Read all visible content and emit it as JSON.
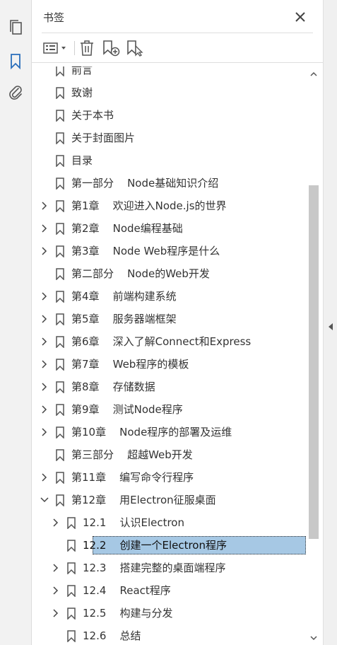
{
  "panel": {
    "title": "书签"
  },
  "colors": {
    "accent": "#2a6ebb",
    "selection_bg": "#a6c8e4",
    "scroll_thumb": "#c8c8c8",
    "rail_bg": "#f2f2f2"
  },
  "rail": {
    "icons": [
      "pages-icon",
      "bookmark-icon",
      "attachment-icon"
    ],
    "active": "bookmark-icon"
  },
  "toolbar": {
    "icons": [
      "options-menu-icon",
      "delete-bookmark-icon",
      "new-bookmark-icon",
      "bookmark-from-selection-icon"
    ]
  },
  "bookmarks": [
    {
      "label": "前言",
      "level": 0,
      "expandable": false,
      "partial": true
    },
    {
      "label": "致谢",
      "level": 0,
      "expandable": false
    },
    {
      "label": "关于本书",
      "level": 0,
      "expandable": false
    },
    {
      "label": "关于封面图片",
      "level": 0,
      "expandable": false
    },
    {
      "label": "目录",
      "level": 0,
      "expandable": false
    },
    {
      "label": "第一部分    Node基础知识介绍",
      "level": 0,
      "expandable": false
    },
    {
      "label": "第1章    欢迎进入Node.js的世界",
      "level": 0,
      "expandable": true,
      "expanded": false
    },
    {
      "label": "第2章    Node编程基础",
      "level": 0,
      "expandable": true,
      "expanded": false
    },
    {
      "label": "第3章    Node Web程序是什么",
      "level": 0,
      "expandable": true,
      "expanded": false
    },
    {
      "label": "第二部分    Node的Web开发",
      "level": 0,
      "expandable": false
    },
    {
      "label": "第4章    前端构建系统",
      "level": 0,
      "expandable": true,
      "expanded": false
    },
    {
      "label": "第5章    服务器端框架",
      "level": 0,
      "expandable": true,
      "expanded": false
    },
    {
      "label": "第6章    深入了解Connect和Express",
      "level": 0,
      "expandable": true,
      "expanded": false
    },
    {
      "label": "第7章    Web程序的模板",
      "level": 0,
      "expandable": true,
      "expanded": false
    },
    {
      "label": "第8章    存储数据",
      "level": 0,
      "expandable": true,
      "expanded": false
    },
    {
      "label": "第9章    测试Node程序",
      "level": 0,
      "expandable": true,
      "expanded": false
    },
    {
      "label": "第10章    Node程序的部署及运维",
      "level": 0,
      "expandable": true,
      "expanded": false
    },
    {
      "label": "第三部分    超越Web开发",
      "level": 0,
      "expandable": false
    },
    {
      "label": "第11章    编写命令行程序",
      "level": 0,
      "expandable": true,
      "expanded": false
    },
    {
      "label": "第12章    用Electron征服桌面",
      "level": 0,
      "expandable": true,
      "expanded": true
    },
    {
      "label": "12.1    认识Electron",
      "level": 1,
      "expandable": true,
      "expanded": false
    },
    {
      "label": "12.2    创建一个Electron程序",
      "level": 1,
      "expandable": false,
      "selected": true
    },
    {
      "label": "12.3    搭建完整的桌面端程序",
      "level": 1,
      "expandable": true,
      "expanded": false
    },
    {
      "label": "12.4    React程序",
      "level": 1,
      "expandable": true,
      "expanded": false
    },
    {
      "label": "12.5    构建与分发",
      "level": 1,
      "expandable": true,
      "expanded": false
    },
    {
      "label": "12.6    总结",
      "level": 1,
      "expandable": false
    }
  ]
}
